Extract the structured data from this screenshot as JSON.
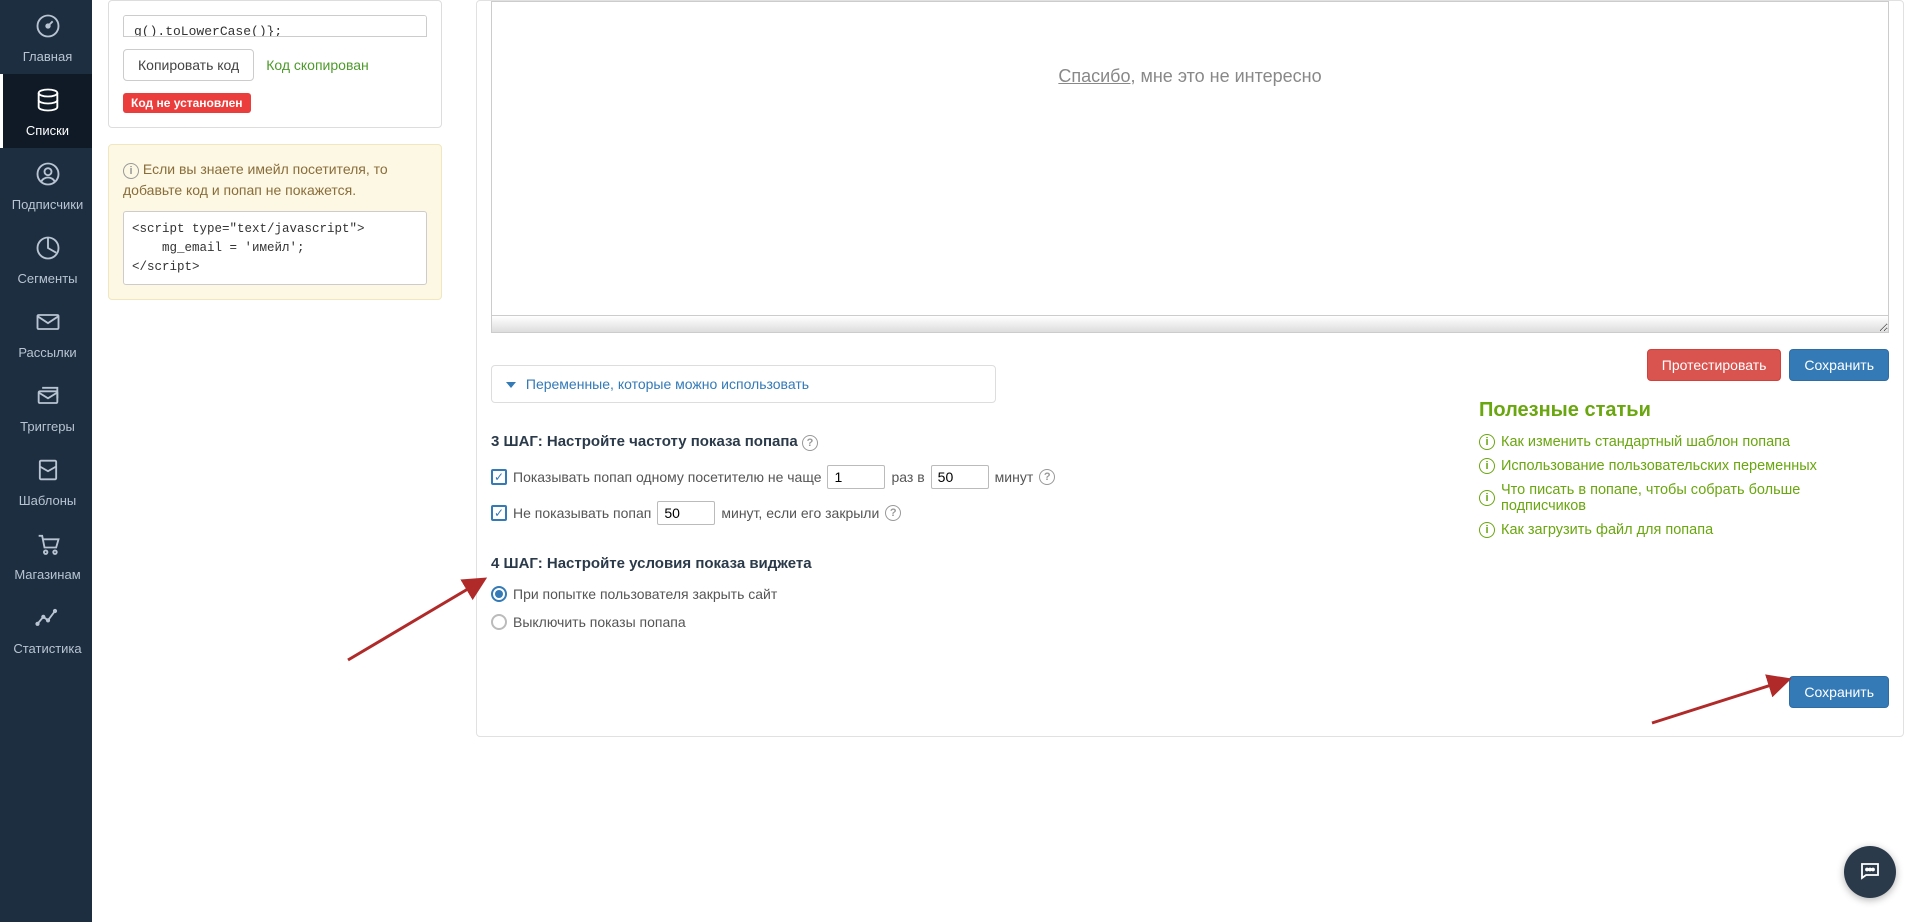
{
  "sidebar": {
    "items": [
      {
        "label": "Главная"
      },
      {
        "label": "Списки"
      },
      {
        "label": "Подписчики"
      },
      {
        "label": "Сегменты"
      },
      {
        "label": "Рассылки"
      },
      {
        "label": "Триггеры"
      },
      {
        "label": "Шаблоны"
      },
      {
        "label": "Магазинам"
      },
      {
        "label": "Статистика"
      }
    ]
  },
  "left_panel": {
    "code_snippet_top": "g().toLowerCase()};",
    "copy_btn": "Копировать код",
    "copied_msg": "Код скопирован",
    "not_installed_badge": "Код не установлен",
    "info_text": "Если вы знаете имейл посетителя, то добавьте код и попап не покажется.",
    "email_script": "<script type=\"text/javascript\">\n    mg_email = 'имейл';\n</script>"
  },
  "preview": {
    "underlined": "Спасибо",
    "rest": ", мне это не интересно"
  },
  "vars_toggle": "Переменные, которые можно использовать",
  "buttons": {
    "test": "Протестировать",
    "save": "Сохранить"
  },
  "step3": {
    "title": "3 ШАГ: Настройте частоту показа попапа",
    "row1_pre": "Показывать попап одному посетителю не чаще",
    "row1_mid": "раз в",
    "row1_post": "минут",
    "row1_val1": "1",
    "row1_val2": "50",
    "row2_pre": "Не показывать попап",
    "row2_post": "минут, если его закрыли",
    "row2_val": "50"
  },
  "step4": {
    "title": "4 ШАГ: Настройте условия показа виджета",
    "opt1": "При попытке пользователя закрыть сайт",
    "opt2": "Выключить показы попапа"
  },
  "articles": {
    "title": "Полезные статьи",
    "items": [
      "Как изменить стандартный шаблон попапа",
      "Использование пользовательских переменных",
      "Что писать в попапе, чтобы собрать больше подписчиков",
      "Как загрузить файл для попапа"
    ]
  }
}
